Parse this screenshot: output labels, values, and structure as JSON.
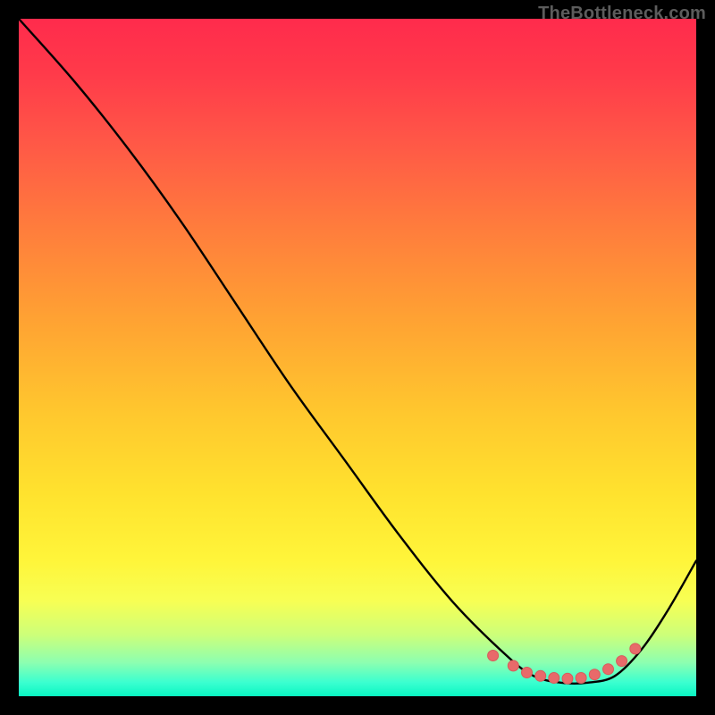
{
  "watermark": "TheBottleneck.com",
  "colors": {
    "page_bg": "#000000",
    "curve": "#000000",
    "dot_fill": "#e86a6a",
    "dot_stroke": "#d85b5b"
  },
  "chart_data": {
    "type": "line",
    "title": "",
    "xlabel": "",
    "ylabel": "",
    "xlim": [
      0,
      100
    ],
    "ylim": [
      0,
      100
    ],
    "series": [
      {
        "name": "bottleneck-curve",
        "x": [
          0,
          8,
          16,
          24,
          32,
          40,
          48,
          56,
          64,
          72,
          76,
          80,
          84,
          88,
          92,
          96,
          100
        ],
        "y": [
          100,
          91,
          81,
          70,
          58,
          46,
          35,
          24,
          14,
          6,
          3,
          2,
          2,
          3,
          7,
          13,
          20
        ]
      }
    ],
    "highlight_dots": {
      "name": "optimum-band",
      "x": [
        70,
        73,
        75,
        77,
        79,
        81,
        83,
        85,
        87,
        89,
        91
      ],
      "y": [
        6,
        4.5,
        3.5,
        3,
        2.7,
        2.6,
        2.7,
        3.2,
        4,
        5.2,
        7
      ]
    }
  }
}
